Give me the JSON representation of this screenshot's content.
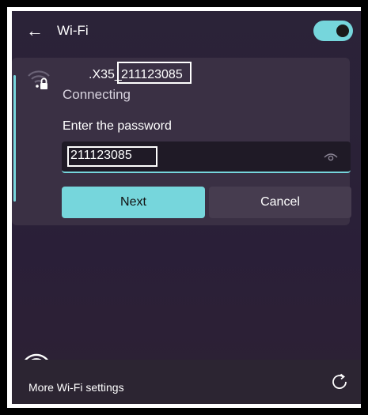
{
  "header": {
    "title": "Wi-Fi",
    "back_icon": "arrow-left-icon",
    "toggle_on": true
  },
  "network": {
    "ssid_prefix": ".X35_",
    "ssid_highlight": "211123085",
    "status": "Connecting",
    "icon": "wifi-secured-icon"
  },
  "password": {
    "label": "Enter the password",
    "value": "211123085",
    "reveal_icon": "eye-icon"
  },
  "buttons": {
    "next_label": "Next",
    "cancel_label": "Cancel"
  },
  "footer": {
    "more_settings": "More Wi-Fi settings",
    "refresh_icon": "refresh-icon"
  },
  "colors": {
    "accent": "#76d6dc",
    "panel": "#2a2137",
    "card": "#3a3044"
  }
}
